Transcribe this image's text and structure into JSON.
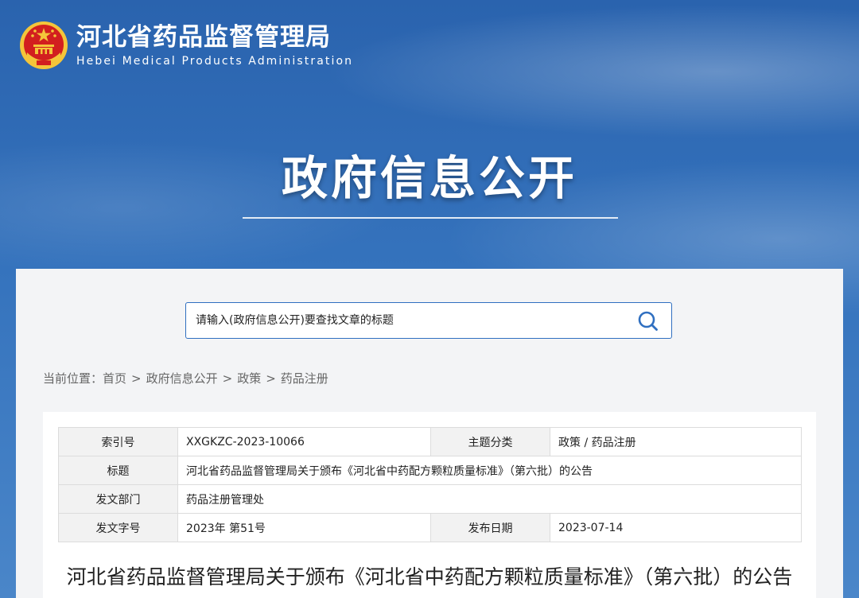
{
  "site": {
    "name_cn": "河北省药品监督管理局",
    "name_en": "Hebei Medical Products Administration"
  },
  "hero": {
    "title": "政府信息公开"
  },
  "search": {
    "placeholder": "请输入(政府信息公开)要查找文章的标题"
  },
  "breadcrumb": {
    "prefix": "当前位置：",
    "items": [
      "首页",
      "政府信息公开",
      "政策",
      "药品注册"
    ],
    "separator": ">"
  },
  "info": {
    "index_label": "索引号",
    "index_value": "XXGKZC-2023-10066",
    "topic_label": "主题分类",
    "topic_value": "政策 / 药品注册",
    "title_label": "标题",
    "title_value": "河北省药品监督管理局关于颁布《河北省中药配方颗粒质量标准》（第六批）的公告",
    "dept_label": "发文部门",
    "dept_value": "药品注册管理处",
    "docno_label": "发文字号",
    "docno_value": "2023年 第51号",
    "date_label": "发布日期",
    "date_value": "2023-07-14"
  },
  "article": {
    "title": "河北省药品监督管理局关于颁布《河北省中药配方颗粒质量标准》（第六批）的公告"
  },
  "icons": {
    "emblem": "national-emblem-icon",
    "search": "search-icon"
  },
  "colors": {
    "banner_blue": "#2f6bb3",
    "accent_blue": "#2f6fc0",
    "emblem_red": "#d21f1f",
    "emblem_gold": "#f4c53a"
  }
}
